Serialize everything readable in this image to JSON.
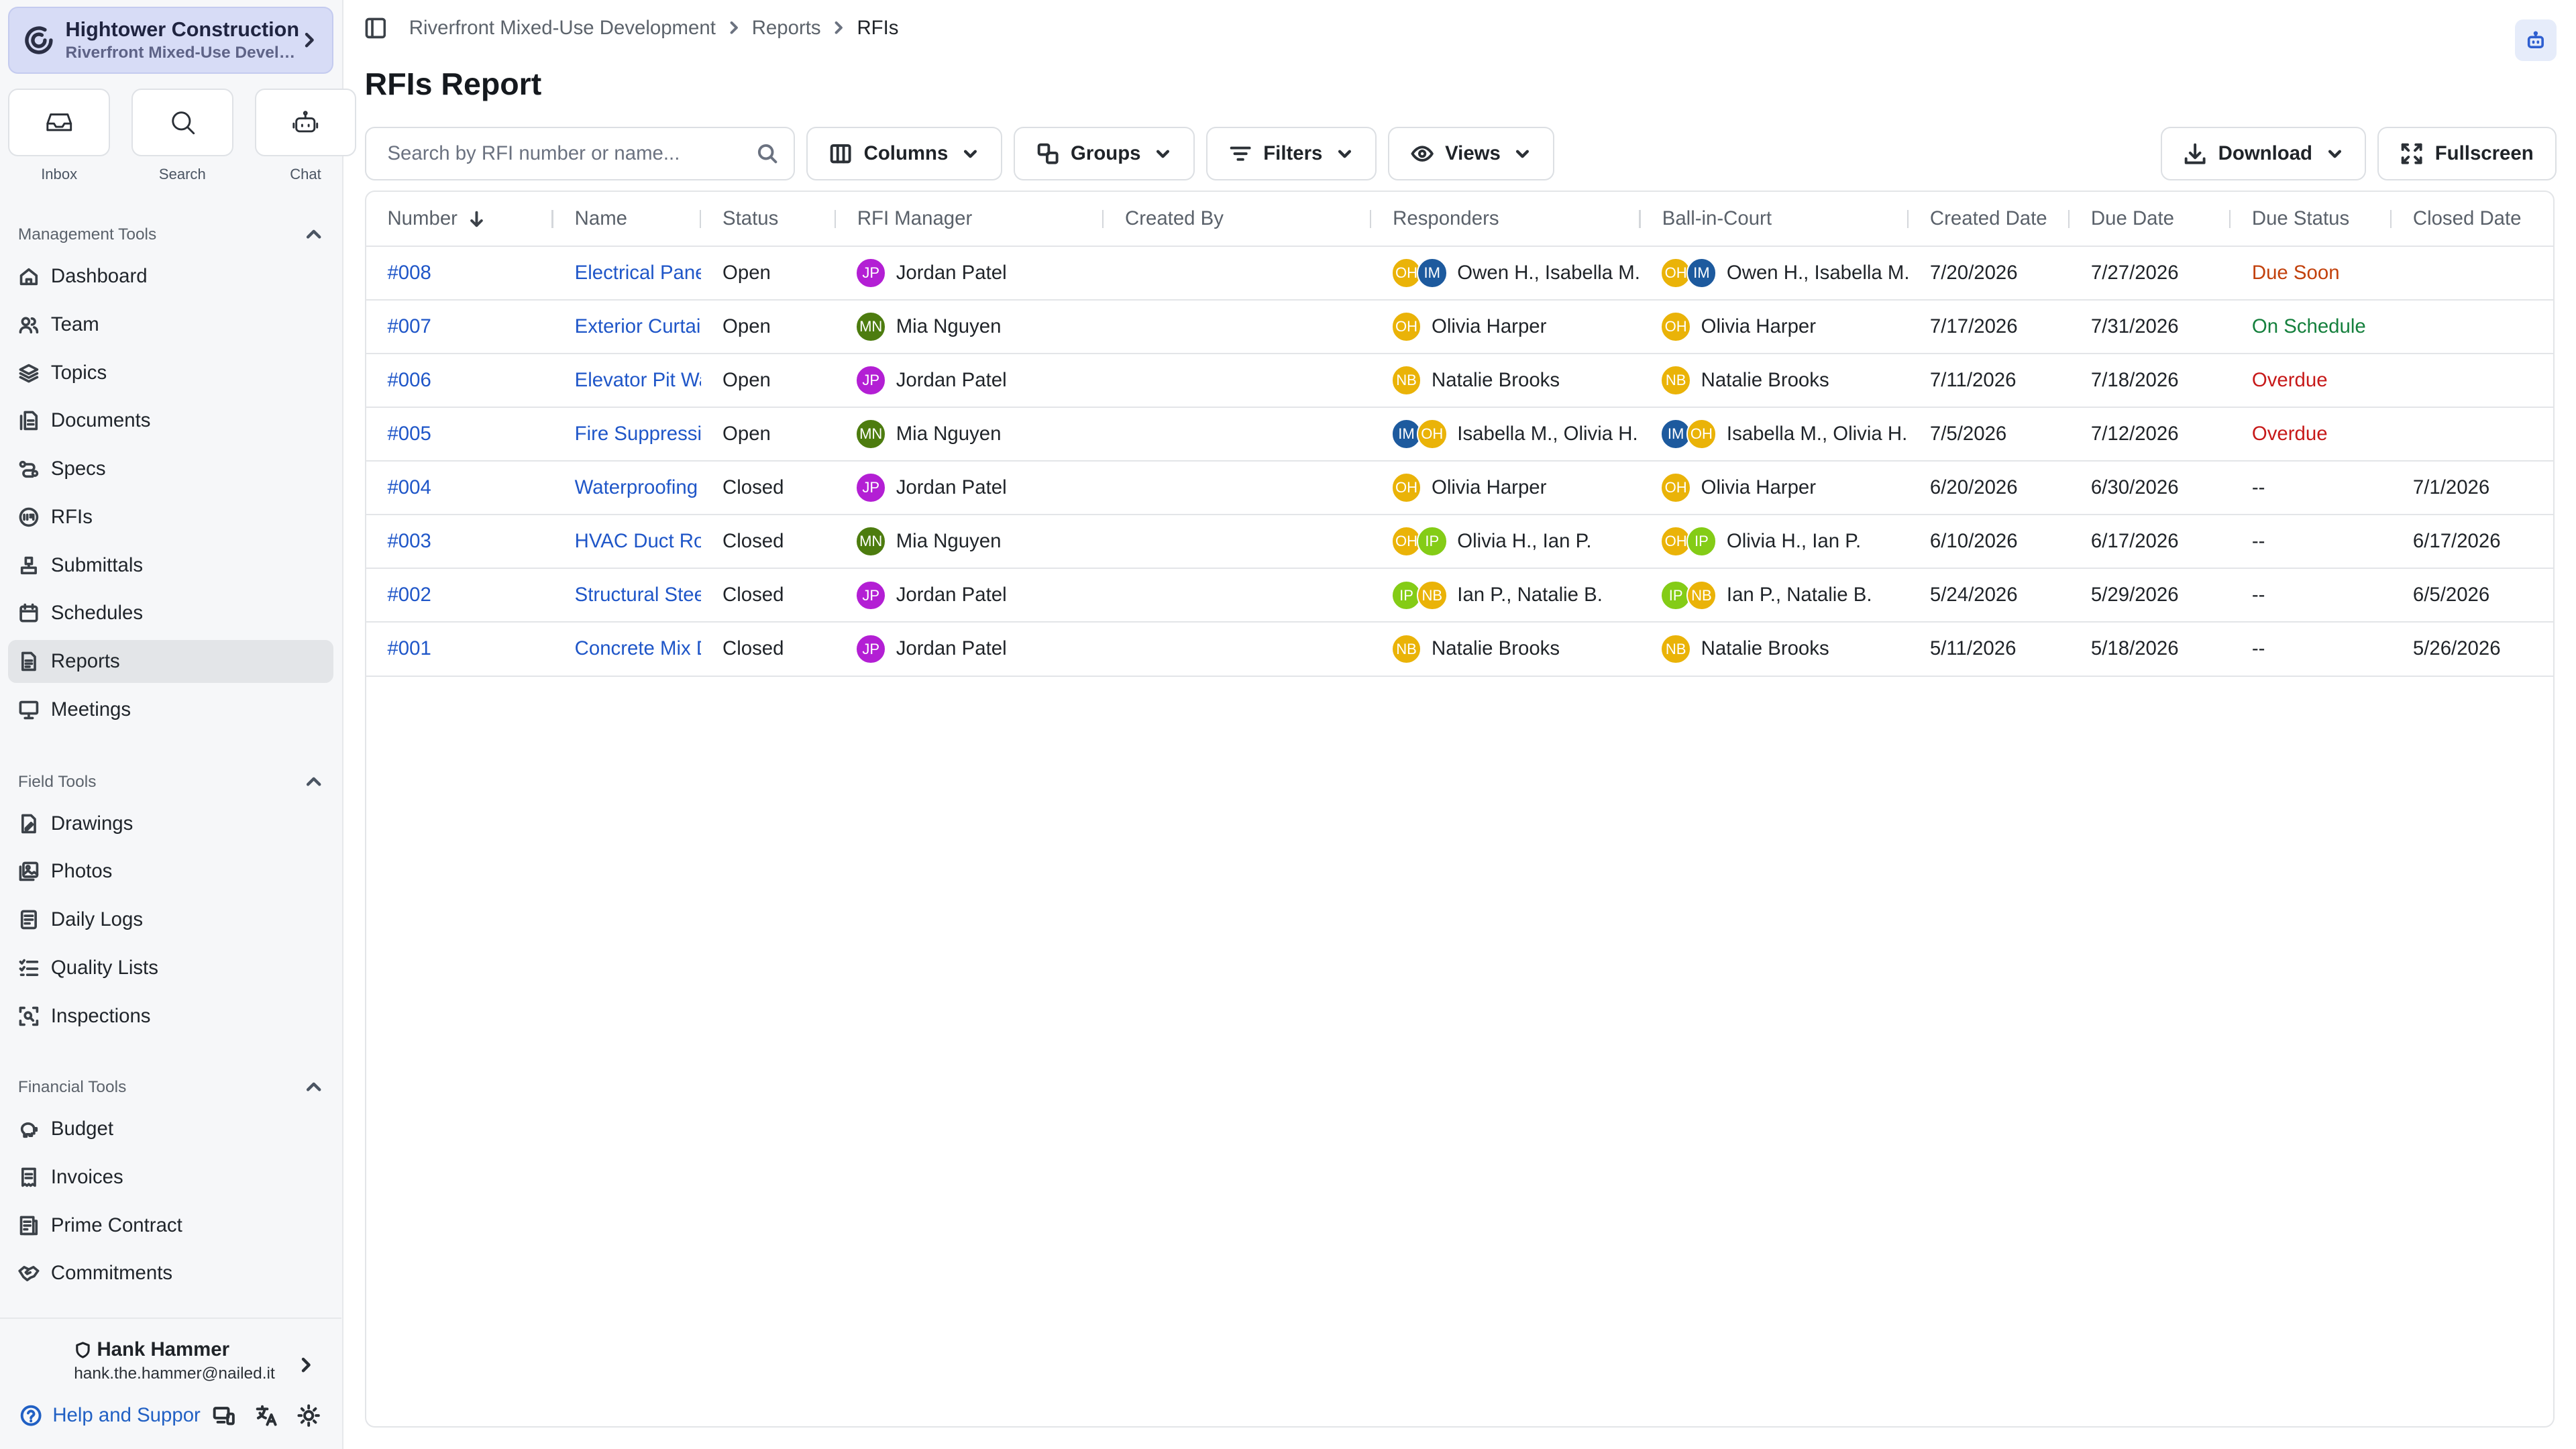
{
  "sidebar": {
    "org_name": "Hightower Construction",
    "org_project": "Riverfront Mixed-Use Development",
    "quick": [
      {
        "label": "Inbox",
        "icon": "inbox-icon"
      },
      {
        "label": "Search",
        "icon": "search-icon"
      },
      {
        "label": "Chat",
        "icon": "chat-bot-icon"
      }
    ],
    "management": {
      "title": "Management Tools",
      "items": [
        {
          "label": "Dashboard",
          "icon": "home-icon"
        },
        {
          "label": "Team",
          "icon": "team-icon"
        },
        {
          "label": "Topics",
          "icon": "layers-icon"
        },
        {
          "label": "Documents",
          "icon": "documents-icon"
        },
        {
          "label": "Specs",
          "icon": "specs-icon"
        },
        {
          "label": "RFIs",
          "icon": "rfi-icon"
        },
        {
          "label": "Submittals",
          "icon": "submittals-icon"
        },
        {
          "label": "Schedules",
          "icon": "calendar-icon"
        },
        {
          "label": "Reports",
          "icon": "report-icon"
        },
        {
          "label": "Meetings",
          "icon": "presentation-icon"
        }
      ]
    },
    "field": {
      "title": "Field Tools",
      "items": [
        {
          "label": "Drawings",
          "icon": "drawing-icon"
        },
        {
          "label": "Photos",
          "icon": "photos-icon"
        },
        {
          "label": "Daily Logs",
          "icon": "daily-log-icon"
        },
        {
          "label": "Quality Lists",
          "icon": "checklist-icon"
        },
        {
          "label": "Inspections",
          "icon": "inspection-icon"
        }
      ]
    },
    "financial": {
      "title": "Financial Tools",
      "items": [
        {
          "label": "Budget",
          "icon": "piggy-bank-icon"
        },
        {
          "label": "Invoices",
          "icon": "invoice-icon"
        },
        {
          "label": "Prime Contract",
          "icon": "contract-icon"
        },
        {
          "label": "Commitments",
          "icon": "handshake-icon"
        }
      ]
    },
    "user": {
      "name": "Hank Hammer",
      "email": "hank.the.hammer@nailed.it"
    },
    "help_label": "Help and Support"
  },
  "header": {
    "breadcrumb": [
      "Riverfront Mixed-Use Development",
      "Reports",
      "RFIs"
    ],
    "title": "RFIs Report"
  },
  "toolbar": {
    "search_placeholder": "Search by RFI number or name...",
    "columns_label": "Columns",
    "groups_label": "Groups",
    "filters_label": "Filters",
    "views_label": "Views",
    "download_label": "Download",
    "fullscreen_label": "Fullscreen"
  },
  "table": {
    "columns": [
      "Number",
      "Name",
      "Status",
      "RFI Manager",
      "Created By",
      "Responders",
      "Ball-in-Court",
      "Created Date",
      "Due Date",
      "Due Status",
      "Closed Date"
    ],
    "rows": [
      {
        "number": "#008",
        "name": "Electrical Panel",
        "status": "Open",
        "manager": {
          "initials": "JP",
          "name": "Jordan Patel"
        },
        "created_by": "",
        "responders": {
          "avatars": [
            "OH",
            "IM"
          ],
          "text": "Owen H., Isabella M."
        },
        "ball": {
          "avatars": [
            "OH",
            "IM"
          ],
          "text": "Owen H., Isabella M."
        },
        "created": "7/20/2026",
        "due": "7/27/2026",
        "due_status": "Due Soon",
        "closed": ""
      },
      {
        "number": "#007",
        "name": "Exterior Curtain Wall",
        "status": "Open",
        "manager": {
          "initials": "MN",
          "name": "Mia Nguyen"
        },
        "created_by": "",
        "responders": {
          "avatars": [
            "OH"
          ],
          "text": "Olivia Harper"
        },
        "ball": {
          "avatars": [
            "OH"
          ],
          "text": "Olivia Harper"
        },
        "created": "7/17/2026",
        "due": "7/31/2026",
        "due_status": "On Schedule",
        "closed": ""
      },
      {
        "number": "#006",
        "name": "Elevator Pit Waterproofing",
        "status": "Open",
        "manager": {
          "initials": "JP",
          "name": "Jordan Patel"
        },
        "created_by": "",
        "responders": {
          "avatars": [
            "NB"
          ],
          "text": "Natalie Brooks"
        },
        "ball": {
          "avatars": [
            "NB"
          ],
          "text": "Natalie Brooks"
        },
        "created": "7/11/2026",
        "due": "7/18/2026",
        "due_status": "Overdue",
        "closed": ""
      },
      {
        "number": "#005",
        "name": "Fire Suppression",
        "status": "Open",
        "manager": {
          "initials": "MN",
          "name": "Mia Nguyen"
        },
        "created_by": "",
        "responders": {
          "avatars": [
            "IM",
            "OH"
          ],
          "text": "Isabella M., Olivia H."
        },
        "ball": {
          "avatars": [
            "IM",
            "OH"
          ],
          "text": "Isabella M., Olivia H."
        },
        "created": "7/5/2026",
        "due": "7/12/2026",
        "due_status": "Overdue",
        "closed": ""
      },
      {
        "number": "#004",
        "name": "Waterproofing",
        "status": "Closed",
        "manager": {
          "initials": "JP",
          "name": "Jordan Patel"
        },
        "created_by": "",
        "responders": {
          "avatars": [
            "OH"
          ],
          "text": "Olivia Harper"
        },
        "ball": {
          "avatars": [
            "OH"
          ],
          "text": "Olivia Harper"
        },
        "created": "6/20/2026",
        "due": "6/30/2026",
        "due_status": "--",
        "closed": "7/1/2026"
      },
      {
        "number": "#003",
        "name": "HVAC Duct Routing",
        "status": "Closed",
        "manager": {
          "initials": "MN",
          "name": "Mia Nguyen"
        },
        "created_by": "",
        "responders": {
          "avatars": [
            "OH",
            "IP"
          ],
          "text": "Olivia H., Ian P."
        },
        "ball": {
          "avatars": [
            "OH",
            "IP"
          ],
          "text": "Olivia H., Ian P."
        },
        "created": "6/10/2026",
        "due": "6/17/2026",
        "due_status": "--",
        "closed": "6/17/2026"
      },
      {
        "number": "#002",
        "name": "Structural Steel",
        "status": "Closed",
        "manager": {
          "initials": "JP",
          "name": "Jordan Patel"
        },
        "created_by": "",
        "responders": {
          "avatars": [
            "IP",
            "NB"
          ],
          "text": "Ian P., Natalie B."
        },
        "ball": {
          "avatars": [
            "IP",
            "NB"
          ],
          "text": "Ian P., Natalie B."
        },
        "created": "5/24/2026",
        "due": "5/29/2026",
        "due_status": "--",
        "closed": "6/5/2026"
      },
      {
        "number": "#001",
        "name": "Concrete Mix Design",
        "status": "Closed",
        "manager": {
          "initials": "JP",
          "name": "Jordan Patel"
        },
        "created_by": "",
        "responders": {
          "avatars": [
            "NB"
          ],
          "text": "Natalie Brooks"
        },
        "ball": {
          "avatars": [
            "NB"
          ],
          "text": "Natalie Brooks"
        },
        "created": "5/11/2026",
        "due": "5/18/2026",
        "due_status": "--",
        "closed": "5/26/2026"
      }
    ]
  },
  "avatar_colors": {
    "JP": "#b31fd4",
    "MN": "#4d7c0f",
    "OH": "#eab308",
    "IM": "#1d5a9e",
    "NB": "#eab308",
    "IP": "#84cc16"
  },
  "status_colors": {
    "Due Soon": "#c2410c",
    "On Schedule": "#15803d",
    "Overdue": "#c71919"
  },
  "colors": {
    "accent": "#1f56c8",
    "org_switch_bg": "#d7dcf6",
    "active_nav_bg": "#e3e5e8"
  }
}
